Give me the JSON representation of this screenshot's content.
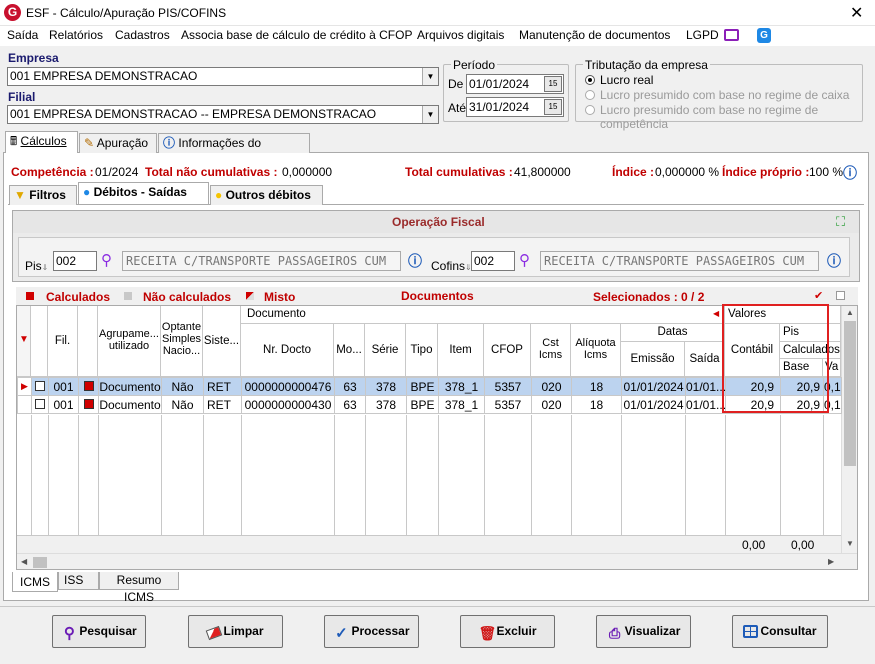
{
  "window": {
    "title": "ESF - Cálculo/Apuração PIS/COFINS",
    "logo": "G"
  },
  "menu": [
    "Saída",
    "Relatórios",
    "Cadastros",
    "Associa base de cálculo de crédito à CFOP",
    "Arquivos digitais",
    "Manutenção de documentos",
    "LGPD"
  ],
  "empresa": {
    "label": "Empresa",
    "value": "001 EMPRESA DEMONSTRACAO"
  },
  "filial": {
    "label": "Filial",
    "value": "001 EMPRESA DEMONSTRACAO -- EMPRESA DEMONSTRACAO"
  },
  "periodo": {
    "title": "Período",
    "de_label": "De",
    "de": "01/01/2024",
    "ate_label": "Até",
    "ate": "31/01/2024"
  },
  "tributacao": {
    "title": "Tributação da empresa",
    "options": [
      "Lucro real",
      "Lucro presumido com base no regime de caixa",
      "Lucro presumido com base no regime de competência"
    ]
  },
  "top_tabs": [
    "Cálculos",
    "Apuração",
    "Informações do sistema"
  ],
  "status": {
    "competencia_label": "Competência :",
    "competencia": "01/2024",
    "total_nc_label": "Total não cumulativas :",
    "total_nc": "0,000000",
    "total_c_label": "Total cumulativas :",
    "total_c": "41,800000",
    "indice_label": "Índice :",
    "indice": "0,000000 %",
    "indice_proprio_label": "Índice próprio :",
    "indice_proprio": "100 %"
  },
  "sub_tabs": [
    "Filtros",
    "Débitos - Saídas",
    "Outros débitos"
  ],
  "operacao": {
    "title": "Operação Fiscal",
    "pis_label": "Pis",
    "pis_code": "002",
    "pis_desc": "RECEITA C/TRANSPORTE PASSAGEIROS CUM",
    "cofins_label": "Cofins",
    "cofins_code": "002",
    "cofins_desc": "RECEITA C/TRANSPORTE PASSAGEIROS CUM"
  },
  "legend": {
    "calculados": "Calculados",
    "nao_calculados": "Não calculados",
    "misto": "Misto",
    "documentos": "Documentos",
    "selecionados": "Selecionados : 0 / 2"
  },
  "grid": {
    "headers": {
      "fil": "Fil.",
      "agrup": "Agrupame... utilizado",
      "optante": "Optante Simples Nacio...",
      "sistema": "Siste...",
      "documento": "Documento",
      "nr_docto": "Nr. Docto",
      "mo": "Mo...",
      "serie": "Série",
      "tipo": "Tipo",
      "item": "Item",
      "cfop": "CFOP",
      "cst": "Cst Icms",
      "aliq": "Alíquota Icms",
      "datas": "Datas",
      "emissao": "Emissão",
      "saida": "Saída",
      "valores": "Valores",
      "contabil": "Contábil",
      "pis": "Pis",
      "calculados": "Calculados...",
      "base": "Base",
      "va": "Va"
    },
    "rows": [
      {
        "fil": "001",
        "agrup": "Documento",
        "optante": "Não",
        "sistema": "RET",
        "nr": "0000000000476",
        "mo": "63",
        "serie": "378",
        "tipo": "BPE",
        "item": "378_1",
        "cfop": "5357",
        "cst": "020",
        "aliq": "18",
        "emissao": "01/01/2024",
        "saida": "01/01...",
        "contabil": "20,9",
        "base": "20,9",
        "va": "0,1"
      },
      {
        "fil": "001",
        "agrup": "Documento",
        "optante": "Não",
        "sistema": "RET",
        "nr": "0000000000430",
        "mo": "63",
        "serie": "378",
        "tipo": "BPE",
        "item": "378_1",
        "cfop": "5357",
        "cst": "020",
        "aliq": "18",
        "emissao": "01/01/2024",
        "saida": "01/01...",
        "contabil": "20,9",
        "base": "20,9",
        "va": "0,1"
      }
    ],
    "totals": {
      "contabil": "0,00",
      "base": "0,00"
    }
  },
  "bottom_tabs": [
    "ICMS",
    "ISS",
    "Resumo ICMS"
  ],
  "buttons": {
    "pesquisar": "Pesquisar",
    "limpar": "Limpar",
    "processar": "Processar",
    "excluir": "Excluir",
    "visualizar": "Visualizar",
    "consultar": "Consultar"
  }
}
